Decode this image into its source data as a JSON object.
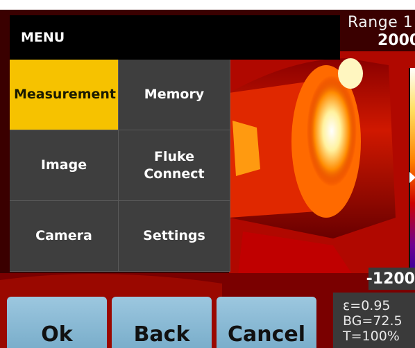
{
  "range": {
    "title": "Range 1",
    "max": "2000",
    "min": "-1200"
  },
  "menu": {
    "title": "MENU",
    "items": [
      {
        "label": "Measurement",
        "selected": true
      },
      {
        "label": "Memory",
        "selected": false
      },
      {
        "label": "Image",
        "selected": false
      },
      {
        "label": "Fluke\nConnect",
        "selected": false
      },
      {
        "label": "Camera",
        "selected": false
      },
      {
        "label": "Settings",
        "selected": false
      }
    ]
  },
  "buttons": {
    "ok": "Ok",
    "back": "Back",
    "cancel": "Cancel"
  },
  "status": {
    "emissivity": "ε=0.95",
    "background": "BG=72.5",
    "transmission": "T=100%"
  },
  "colors": {
    "accent": "#f6c200",
    "button": "#8fbcd6",
    "menu_bg": "#3e3e3e"
  }
}
